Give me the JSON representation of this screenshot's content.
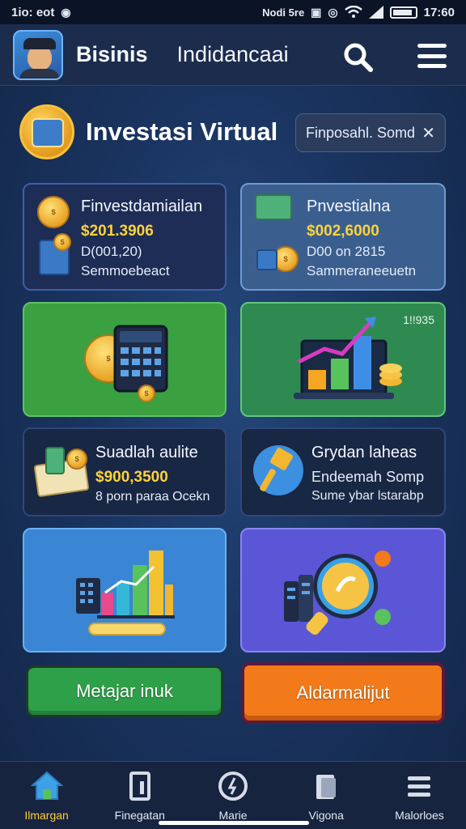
{
  "status_bar": {
    "time": "1io: eot",
    "carrier": "Nodi 5re",
    "clock": "17:60"
  },
  "app_bar": {
    "avatar_icon": "user-avatar",
    "title": "Bisinis",
    "tab": "Indidancaai",
    "search_icon": "search-icon",
    "menu_icon": "hamburger-menu-icon"
  },
  "section": {
    "icon": "investment-coin-icon",
    "title": "Investasi Virtual",
    "chip_label": "Finposahl. Somd",
    "chip_close": "✕"
  },
  "cards": {
    "card1": {
      "title": "Finvestdamiailan",
      "amount": "$201.3906",
      "sub": "D(001,20)",
      "note": "Semmoebeact"
    },
    "card2": {
      "title": "Pnvestialna",
      "amount": "$002,6000",
      "sub": "D00 on 2815",
      "note": "Sammeraneeuetn"
    },
    "card4": {
      "badge": "1!!935"
    },
    "card5": {
      "title": "Suadlah aulite",
      "amount": "$900,3500",
      "note": "8 porn paraa Ocekn"
    },
    "card6": {
      "title": "Grydan laheas",
      "sub": "Endeemah Somp",
      "note": "Sume ybar lstarabp"
    }
  },
  "buttons": {
    "primary": "Metajar inuk",
    "secondary": "Aldarmalijut"
  },
  "bottom_nav": [
    {
      "icon": "home-icon",
      "label": "Ilmargan",
      "active": true
    },
    {
      "icon": "document-icon",
      "label": "Finegatan",
      "active": false
    },
    {
      "icon": "clock-icon",
      "label": "Marie",
      "active": false
    },
    {
      "icon": "file-icon",
      "label": "Vigona",
      "active": false
    },
    {
      "icon": "menu-icon",
      "label": "Malorloes",
      "active": false
    }
  ],
  "colors": {
    "accent_gold": "#ffd23c",
    "green_button": "#2fa04a",
    "orange_button": "#f37a1a",
    "card_navy": "#1d2d55",
    "card_green": "#3aa040",
    "card_purple": "#5b56d6"
  }
}
